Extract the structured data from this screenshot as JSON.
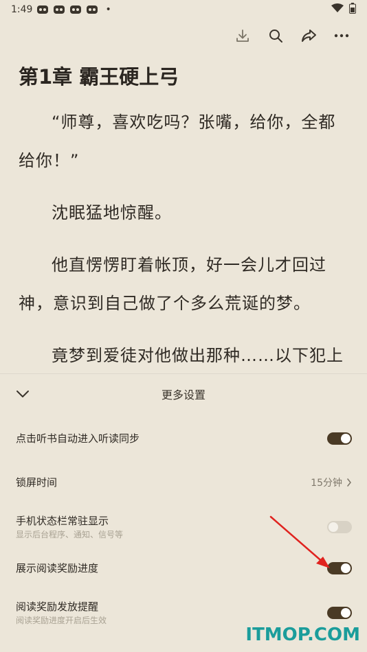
{
  "status_bar": {
    "time": "1:49",
    "notification_icons": [
      "cartoon-app-icon",
      "cartoon-app-icon",
      "cartoon-app-icon",
      "cartoon-app-icon"
    ],
    "dot": "•"
  },
  "toolbar": {
    "icons": [
      "download-icon",
      "search-icon",
      "share-icon",
      "more-icon"
    ]
  },
  "reader": {
    "chapter_title": "第1章 霸王硬上弓",
    "paragraphs": [
      "“师尊，喜欢吃吗？张嘴，给你，全都给你！”",
      "沈眠猛地惊醒。",
      "他直愣愣盯着帐顶，好一会儿才回过神，意识到自己做了个多么荒诞的梦。",
      "竟梦到爱徒对他做出那种……以下犯上"
    ]
  },
  "settings_sheet": {
    "title": "更多设置",
    "rows": {
      "auto_sync": {
        "label": "点击听书自动进入听读同步",
        "enabled": true
      },
      "lock_time": {
        "label": "锁屏时间",
        "value": "15分钟"
      },
      "status_bar": {
        "label": "手机状态栏常驻显示",
        "sublabel": "显示后台程序、通知、信号等",
        "enabled": false
      },
      "reward_progress": {
        "label": "展示阅读奖励进度",
        "enabled": true
      },
      "reward_reminder": {
        "label": "阅读奖励发放提醒",
        "sublabel": "阅读奖励进度开启后生效",
        "enabled": true
      }
    }
  },
  "watermark": "ITMOP.COM",
  "colors": {
    "background": "#ece6d9",
    "toggle_on": "#4a3a25",
    "toggle_off": "#d8d2c5",
    "annotation_arrow": "#e0231f",
    "watermark": "#1b9d9b"
  }
}
